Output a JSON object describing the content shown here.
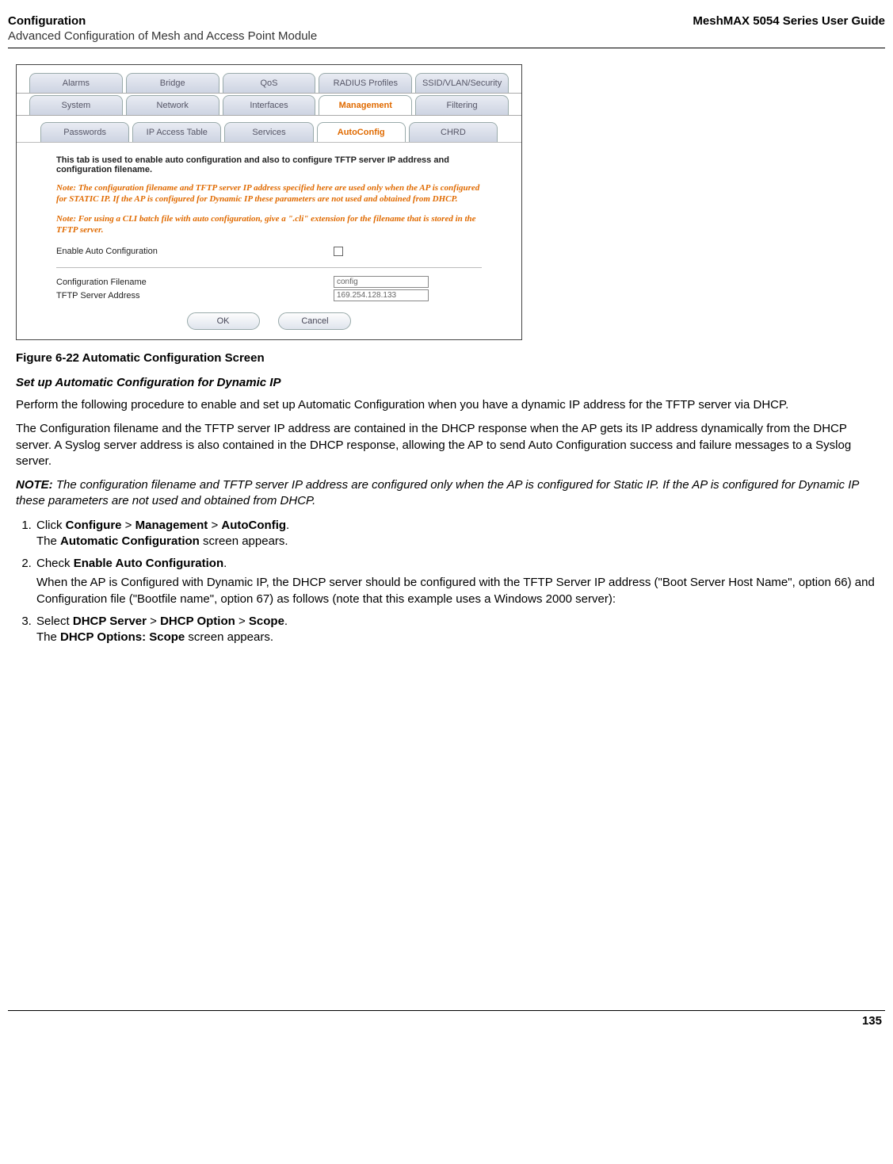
{
  "header": {
    "left_bold": "Configuration",
    "left_sub": "Advanced Configuration of Mesh and Access Point Module",
    "right": "MeshMAX 5054 Series User Guide"
  },
  "screenshot": {
    "tabs_row1": [
      "Alarms",
      "Bridge",
      "QoS",
      "RADIUS Profiles",
      "SSID/VLAN/Security"
    ],
    "tabs_row2": [
      "System",
      "Network",
      "Interfaces",
      "Management",
      "Filtering"
    ],
    "tabs_row3": [
      "Passwords",
      "IP Access Table",
      "Services",
      "AutoConfig",
      "CHRD"
    ],
    "active_r2": "Management",
    "active_r3": "AutoConfig",
    "hint": "This tab is used to enable auto configuration and also to configure TFTP server IP address and configuration filename.",
    "note1": "Note: The configuration filename and TFTP server IP address specified here are used only when the AP is configured for STATIC IP. If the AP is configured for Dynamic IP these parameters are not used and obtained from DHCP.",
    "note2": "Note: For using a CLI batch file with auto configuration, give a \".cli\" extension for the filename that is stored in the TFTP server.",
    "enable_label": "Enable Auto Configuration",
    "cfg_fn_label": "Configuration Filename",
    "cfg_fn_value": "config",
    "tftp_label": "TFTP Server Address",
    "tftp_value": "169.254.128.133",
    "btn_ok": "OK",
    "btn_cancel": "Cancel"
  },
  "fig_caption": "Figure 6-22 Automatic Configuration Screen",
  "section_heading": "Set up Automatic Configuration for Dynamic IP",
  "para1": "Perform the following procedure to enable and set up Automatic Configuration when you have a dynamic IP address for the TFTP server via DHCP.",
  "para2": "The Configuration filename and the TFTP server IP address are contained in the DHCP response when the AP gets its IP address dynamically from the DHCP server. A Syslog server address is also contained in the DHCP response, allowing the AP to send Auto Configuration success and failure messages to a Syslog server.",
  "note_label": "NOTE:",
  "note_text": "The configuration filename and TFTP server IP address are configured only when the AP is configured for Static IP. If the AP is configured for Dynamic IP these parameters are not used and obtained from DHCP.",
  "steps": {
    "s1a": "Click ",
    "s1b1": "Configure",
    "s1b2": "Management",
    "s1b3": "AutoConfig",
    "s1c": "The ",
    "s1d": "Automatic Configuration",
    "s1e": " screen appears.",
    "s2a": "Check ",
    "s2b": "Enable Auto Configuration",
    "s2c": "When the AP is Configured with Dynamic IP, the DHCP server should be configured with the TFTP Server IP address (\"Boot Server Host Name\", option 66) and Configuration file (\"Bootfile name\", option 67) as follows (note that this example uses a Windows 2000 server):",
    "s3a": "Select ",
    "s3b1": "DHCP Server",
    "s3b2": "DHCP Option",
    "s3b3": "Scope",
    "s3c": "The ",
    "s3d": "DHCP Options: Scope",
    "s3e": " screen appears."
  },
  "page_number": "135"
}
